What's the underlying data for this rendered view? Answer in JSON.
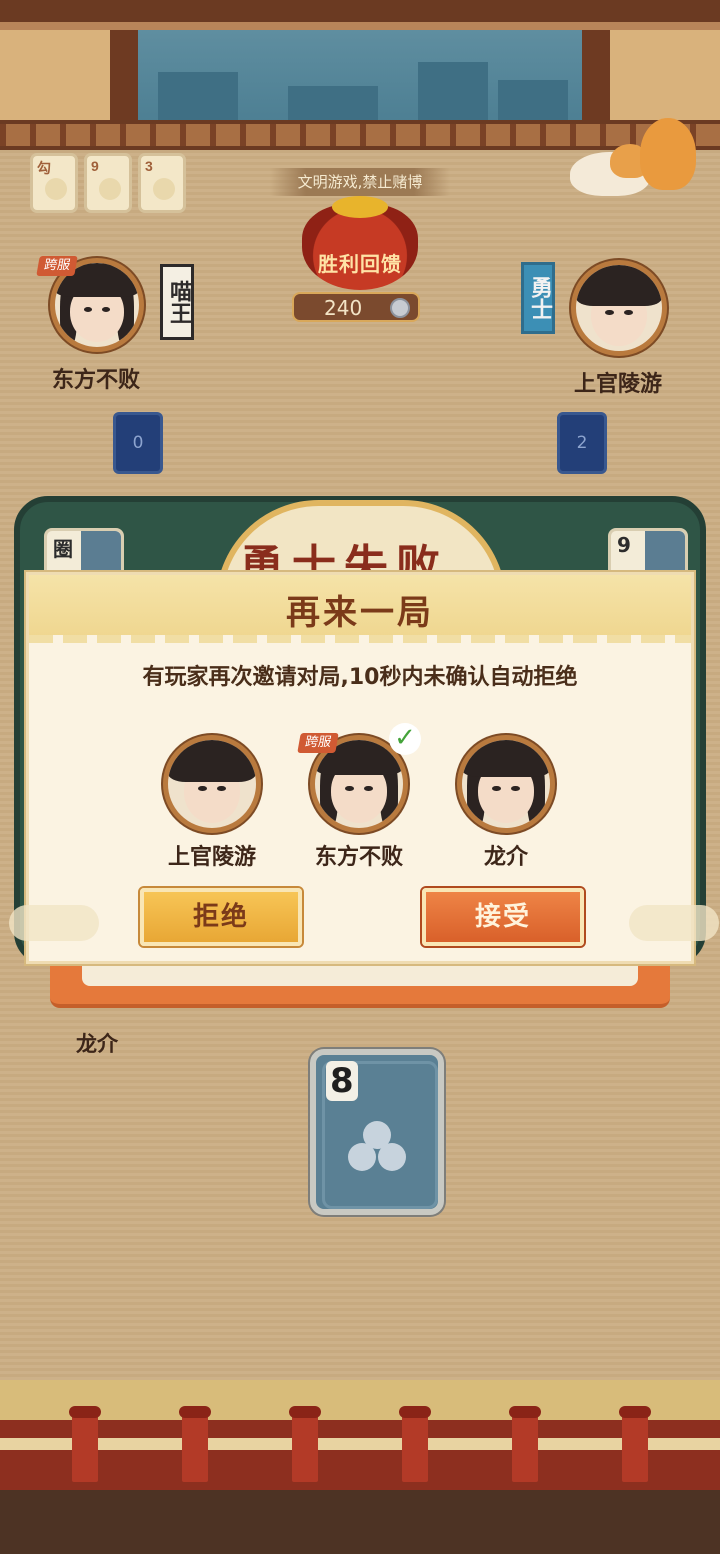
{
  "notice": "文明游戏,禁止赌博",
  "record_cards": [
    "勾",
    "9",
    "3"
  ],
  "reward": {
    "label": "胜利回馈",
    "amount": "240"
  },
  "players": {
    "left": {
      "name": "东方不败",
      "tag": "跨服",
      "title": "喵王",
      "card_count": "0"
    },
    "right": {
      "name": "上官陵游",
      "title": "勇士",
      "card_count": "2"
    },
    "bottom": {
      "name": "龙介"
    }
  },
  "result": {
    "title": "勇士失败",
    "left_card": "圈",
    "right_card": "9"
  },
  "dialog": {
    "title": "再来一局",
    "message": "有玩家再次邀请对局,10秒内未确认自动拒绝",
    "invitees": [
      {
        "name": "上官陵游",
        "tag": "",
        "confirmed": false
      },
      {
        "name": "东方不败",
        "tag": "跨服",
        "confirmed": true
      },
      {
        "name": "龙介",
        "tag": "",
        "confirmed": false
      }
    ],
    "reject_label": "拒绝",
    "accept_label": "接受"
  },
  "hand_card": {
    "rank": "8",
    "suit": "club"
  },
  "colors": {
    "accent_orange": "#d9602a",
    "accent_gold": "#e8a735",
    "title_brown": "#7b3a19"
  }
}
